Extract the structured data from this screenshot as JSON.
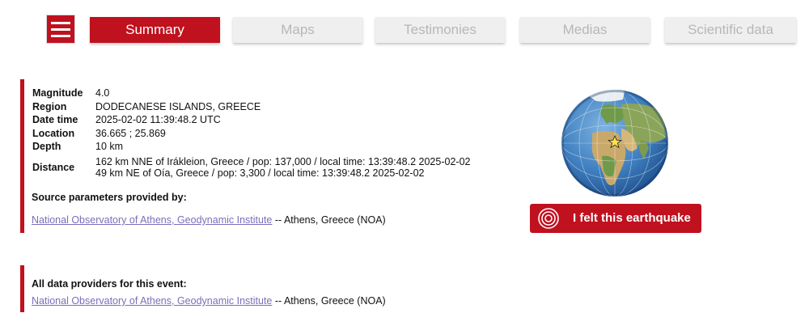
{
  "nav": {
    "tabs": [
      {
        "label": "Summary",
        "active": true
      },
      {
        "label": "Maps",
        "active": false
      },
      {
        "label": "Testimonies",
        "active": false
      },
      {
        "label": "Medias",
        "active": false
      },
      {
        "label": "Scientific data",
        "active": false
      }
    ]
  },
  "summary": {
    "rows": [
      {
        "label": "Magnitude",
        "value": "4.0"
      },
      {
        "label": "Region",
        "value": "DODECANESE ISLANDS, GREECE"
      },
      {
        "label": "Date time",
        "value": "2025-02-02 11:39:48.2 UTC"
      },
      {
        "label": "Location",
        "value": "36.665 ; 25.869"
      },
      {
        "label": "Depth",
        "value": "10 km"
      }
    ],
    "distance_label": "Distance",
    "distance_lines": [
      "162 km NNE of Irákleion, Greece / pop: 137,000 / local time: 13:39:48.2 2025-02-02",
      "49 km NE of Oía, Greece / pop: 3,300 / local time: 13:39:48.2 2025-02-02"
    ],
    "source_title": "Source parameters provided by:",
    "source_link": "National Observatory of Athens, Geodynamic Institute",
    "source_suffix": " -- Athens, Greece (NOA)"
  },
  "providers": {
    "title": "All data providers for this event:",
    "link": "National Observatory of Athens, Geodynamic Institute",
    "suffix": " -- Athens, Greece (NOA)"
  },
  "felt_button": {
    "label": "I felt this earthquake"
  },
  "icons": {
    "menu": "hamburger-icon",
    "felt": "concentric-circles-icon",
    "epicenter": "star-icon",
    "globe": "globe-map"
  },
  "colors": {
    "accent": "#c0111f",
    "tab_inactive_bg": "#efefef",
    "tab_inactive_text": "#b7b7b7",
    "link": "#7a6fb8"
  }
}
